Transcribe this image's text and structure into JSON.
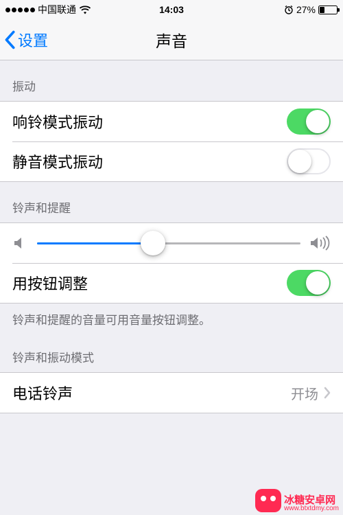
{
  "status_bar": {
    "carrier": "中国联通",
    "time": "14:03",
    "battery_pct": "27%",
    "battery_level": 27
  },
  "nav": {
    "back_label": "设置",
    "title": "声音"
  },
  "sections": {
    "vibrate": {
      "header": "振动",
      "ring_vibrate": {
        "label": "响铃模式振动",
        "on": true
      },
      "silent_vibrate": {
        "label": "静音模式振动",
        "on": false
      }
    },
    "ringer": {
      "header": "铃声和提醒",
      "volume": 44,
      "change_with_buttons": {
        "label": "用按钮调整",
        "on": true
      },
      "footer": "铃声和提醒的音量可用音量按钮调整。"
    },
    "patterns": {
      "header": "铃声和振动模式",
      "ringtone": {
        "label": "电话铃声",
        "value": "开场"
      }
    }
  },
  "watermark": {
    "name": "冰糖安卓网",
    "url": "www.btxtdmy.com"
  }
}
